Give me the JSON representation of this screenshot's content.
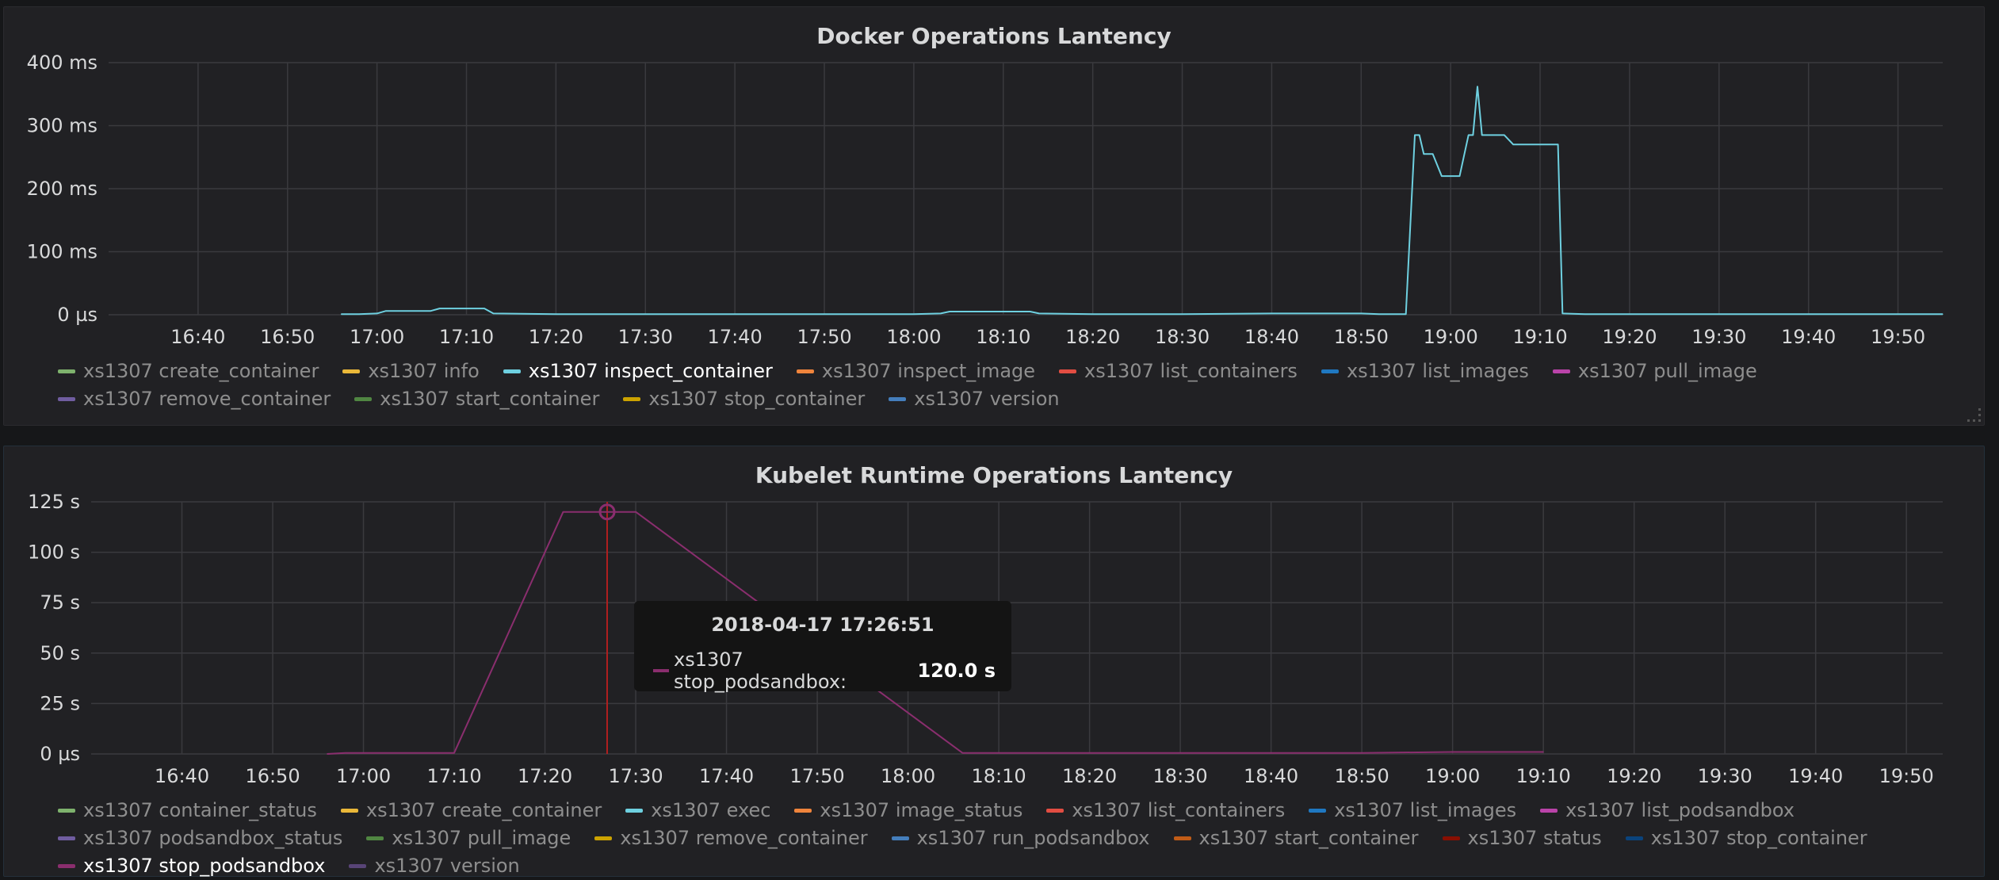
{
  "chart_data": [
    {
      "type": "line",
      "title": "Docker Operations Lantency",
      "x_ticks": [
        "16:40",
        "16:50",
        "17:00",
        "17:10",
        "17:20",
        "17:30",
        "17:40",
        "17:50",
        "18:00",
        "18:10",
        "18:20",
        "18:30",
        "18:40",
        "18:50",
        "19:00",
        "19:10",
        "19:20",
        "19:30",
        "19:40",
        "19:50"
      ],
      "xlim": [
        "16:30",
        "19:55"
      ],
      "y_ticks": [
        "0 µs",
        "100 ms",
        "200 ms",
        "300 ms",
        "400 ms"
      ],
      "ylim_ms": [
        0,
        400
      ],
      "grid": true,
      "legend_placement": "bottom",
      "series": [
        {
          "name": "xs1307 inspect_container",
          "color": "#6ed0e0",
          "unit": "ms",
          "points": [
            [
              "16:56",
              1
            ],
            [
              "16:58",
              1
            ],
            [
              "17:00",
              2
            ],
            [
              "17:01",
              6
            ],
            [
              "17:06",
              6
            ],
            [
              "17:07",
              10
            ],
            [
              "17:12",
              10
            ],
            [
              "17:13",
              2
            ],
            [
              "17:20",
              1
            ],
            [
              "17:30",
              1
            ],
            [
              "17:40",
              1
            ],
            [
              "17:50",
              1
            ],
            [
              "18:00",
              1
            ],
            [
              "18:03",
              2
            ],
            [
              "18:04",
              5
            ],
            [
              "18:13",
              5
            ],
            [
              "18:14",
              2
            ],
            [
              "18:20",
              1
            ],
            [
              "18:30",
              1
            ],
            [
              "18:40",
              2
            ],
            [
              "18:50",
              2
            ],
            [
              "18:52",
              1
            ],
            [
              "18:55",
              1
            ],
            [
              "18:56",
              285
            ],
            [
              "18:56.5",
              285
            ],
            [
              "18:57",
              255
            ],
            [
              "18:58",
              255
            ],
            [
              "18:59",
              220
            ],
            [
              "19:01",
              220
            ],
            [
              "19:02",
              285
            ],
            [
              "19:02.5",
              285
            ],
            [
              "19:03",
              362
            ],
            [
              "19:03.5",
              285
            ],
            [
              "19:06",
              285
            ],
            [
              "19:07",
              270
            ],
            [
              "19:12",
              270
            ],
            [
              "19:12.5",
              2
            ],
            [
              "19:15",
              1
            ],
            [
              "19:30",
              1
            ],
            [
              "19:45",
              1
            ],
            [
              "19:55",
              1
            ]
          ]
        }
      ],
      "legend": [
        {
          "name": "xs1307 create_container",
          "color": "#7eb26d"
        },
        {
          "name": "xs1307 info",
          "color": "#eab839"
        },
        {
          "name": "xs1307 inspect_container",
          "color": "#6ed0e0",
          "active": true
        },
        {
          "name": "xs1307 inspect_image",
          "color": "#ef843c"
        },
        {
          "name": "xs1307 list_containers",
          "color": "#e24d42"
        },
        {
          "name": "xs1307 list_images",
          "color": "#1f78c1"
        },
        {
          "name": "xs1307 pull_image",
          "color": "#ba43a9"
        },
        {
          "name": "xs1307 remove_container",
          "color": "#705da0"
        },
        {
          "name": "xs1307 start_container",
          "color": "#508642"
        },
        {
          "name": "xs1307 stop_container",
          "color": "#cca300"
        },
        {
          "name": "xs1307 version",
          "color": "#447ebc"
        }
      ]
    },
    {
      "type": "line",
      "title": "Kubelet Runtime Operations Lantency",
      "x_ticks": [
        "16:40",
        "16:50",
        "17:00",
        "17:10",
        "17:20",
        "17:30",
        "17:40",
        "17:50",
        "18:00",
        "18:10",
        "18:20",
        "18:30",
        "18:40",
        "18:50",
        "19:00",
        "19:10",
        "19:20",
        "19:30",
        "19:40",
        "19:50"
      ],
      "xlim": [
        "16:30",
        "19:54"
      ],
      "y_ticks": [
        "0 µs",
        "25 s",
        "50 s",
        "75 s",
        "100 s",
        "125 s"
      ],
      "ylim_s": [
        0,
        125
      ],
      "grid": true,
      "legend_placement": "bottom",
      "series": [
        {
          "name": "xs1307 stop_podsandbox",
          "color": "#8a2e6e",
          "unit": "s",
          "points": [
            [
              "16:56",
              0
            ],
            [
              "16:58",
              0.5
            ],
            [
              "17:10",
              0.5
            ],
            [
              "17:22",
              120
            ],
            [
              "17:30",
              120
            ],
            [
              "18:06",
              0.5
            ],
            [
              "18:30",
              0.5
            ],
            [
              "18:50",
              0.5
            ],
            [
              "19:00",
              1
            ],
            [
              "19:10",
              1
            ]
          ]
        }
      ],
      "crosshair_time": "17:26:51",
      "legend": [
        {
          "name": "xs1307 container_status",
          "color": "#7eb26d"
        },
        {
          "name": "xs1307 create_container",
          "color": "#eab839"
        },
        {
          "name": "xs1307 exec",
          "color": "#6ed0e0"
        },
        {
          "name": "xs1307 image_status",
          "color": "#ef843c"
        },
        {
          "name": "xs1307 list_containers",
          "color": "#e24d42"
        },
        {
          "name": "xs1307 list_images",
          "color": "#1f78c1"
        },
        {
          "name": "xs1307 list_podsandbox",
          "color": "#ba43a9"
        },
        {
          "name": "xs1307 podsandbox_status",
          "color": "#705da0"
        },
        {
          "name": "xs1307 pull_image",
          "color": "#508642"
        },
        {
          "name": "xs1307 remove_container",
          "color": "#cca300"
        },
        {
          "name": "xs1307 run_podsandbox",
          "color": "#447ebc"
        },
        {
          "name": "xs1307 start_container",
          "color": "#c15c17"
        },
        {
          "name": "xs1307 status",
          "color": "#890f02"
        },
        {
          "name": "xs1307 stop_container",
          "color": "#0a437c"
        },
        {
          "name": "xs1307 stop_podsandbox",
          "color": "#8a2e6e",
          "active": true
        },
        {
          "name": "xs1307 version",
          "color": "#584477"
        }
      ]
    }
  ],
  "tooltip": {
    "time": "2018-04-17 17:26:51",
    "series": "xs1307 stop_podsandbox:",
    "value": "120.0 s"
  }
}
